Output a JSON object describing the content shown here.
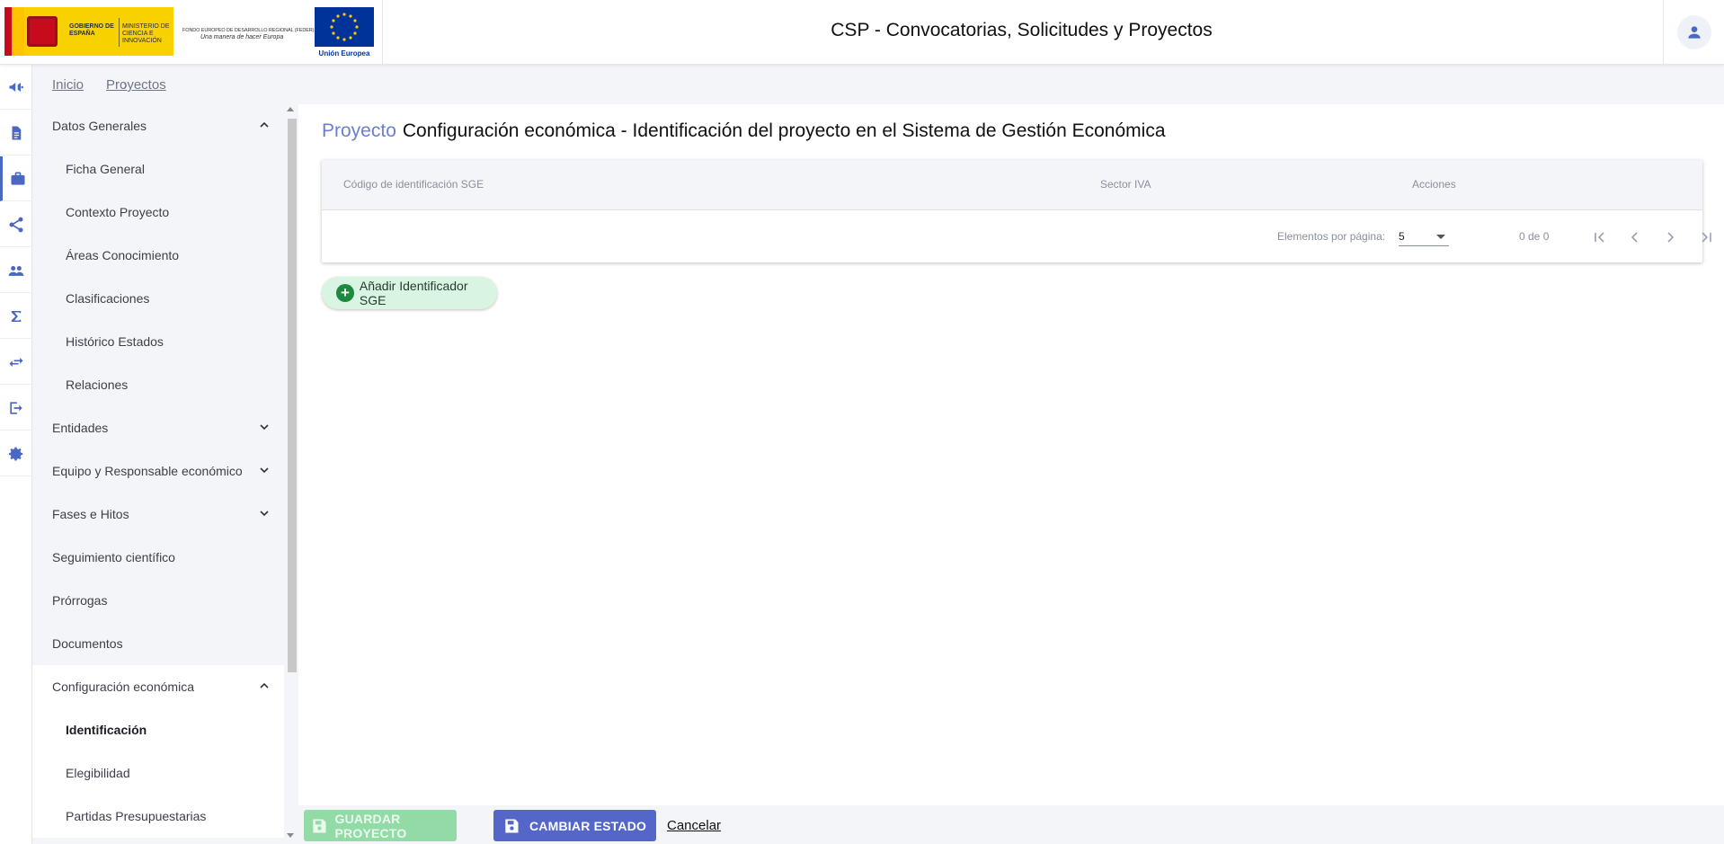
{
  "header": {
    "logo_gobierno": "GOBIERNO DE ESPAÑA",
    "logo_ministerio": "MINISTERIO DE CIENCIA E INNOVACIÓN",
    "feder_title": "FONDO EUROPEO DE DESARROLLO REGIONAL (FEDER)",
    "feder_motto": "Una manera de hacer Europa",
    "eu_label": "Unión Europea",
    "app_title": "CSP - Convocatorias, Solicitudes y Proyectos",
    "user_icon": "account-icon"
  },
  "rail": {
    "icons": [
      "megaphone-icon",
      "document-icon",
      "briefcase-icon",
      "share-icon",
      "people-icon",
      "sigma-icon",
      "swap-icon",
      "exit-icon",
      "gear-icon"
    ],
    "accent": "#4a67c2"
  },
  "breadcrumb": {
    "items": [
      "Inicio",
      "Proyectos"
    ]
  },
  "sidenav": {
    "items": [
      {
        "label": "Datos Generales",
        "level": 1,
        "expanded": true
      },
      {
        "label": "Ficha General",
        "level": 2
      },
      {
        "label": "Contexto Proyecto",
        "level": 2
      },
      {
        "label": "Áreas Conocimiento",
        "level": 2
      },
      {
        "label": "Clasificaciones",
        "level": 2
      },
      {
        "label": "Histórico Estados",
        "level": 2
      },
      {
        "label": "Relaciones",
        "level": 2
      },
      {
        "label": "Entidades",
        "level": 1,
        "expanded": false
      },
      {
        "label": "Equipo y Responsable económico",
        "level": 1,
        "expanded": false
      },
      {
        "label": "Fases e Hitos",
        "level": 1,
        "expanded": false
      },
      {
        "label": "Seguimiento científico",
        "level": 1
      },
      {
        "label": "Prórrogas",
        "level": 1
      },
      {
        "label": "Documentos",
        "level": 1
      },
      {
        "label": "Configuración económica",
        "level": 1,
        "expanded": true,
        "selected": true
      },
      {
        "label": "Identificación",
        "level": 2,
        "active": true
      },
      {
        "label": "Elegibilidad",
        "level": 2
      },
      {
        "label": "Partidas Presupuestarias",
        "level": 2
      }
    ]
  },
  "main": {
    "title_accent": "Proyecto",
    "title": "Configuración económica - Identificación del proyecto en el Sistema de Gestión Económica",
    "accent_color": "#6b7fd1",
    "table": {
      "columns": [
        "Código de identificación SGE",
        "Sector IVA",
        "Acciones"
      ],
      "rows": []
    },
    "paginator": {
      "label": "Elementos por página:",
      "page_size": "5",
      "range": "0 de 0"
    },
    "add_button": "Añadir Identificador SGE"
  },
  "footer": {
    "save_label": "GUARDAR PROYECTO",
    "state_label": "CAMBIAR ESTADO",
    "cancel_label": "Cancelar",
    "save_color": "#93dba6",
    "state_color": "#5467c9"
  }
}
